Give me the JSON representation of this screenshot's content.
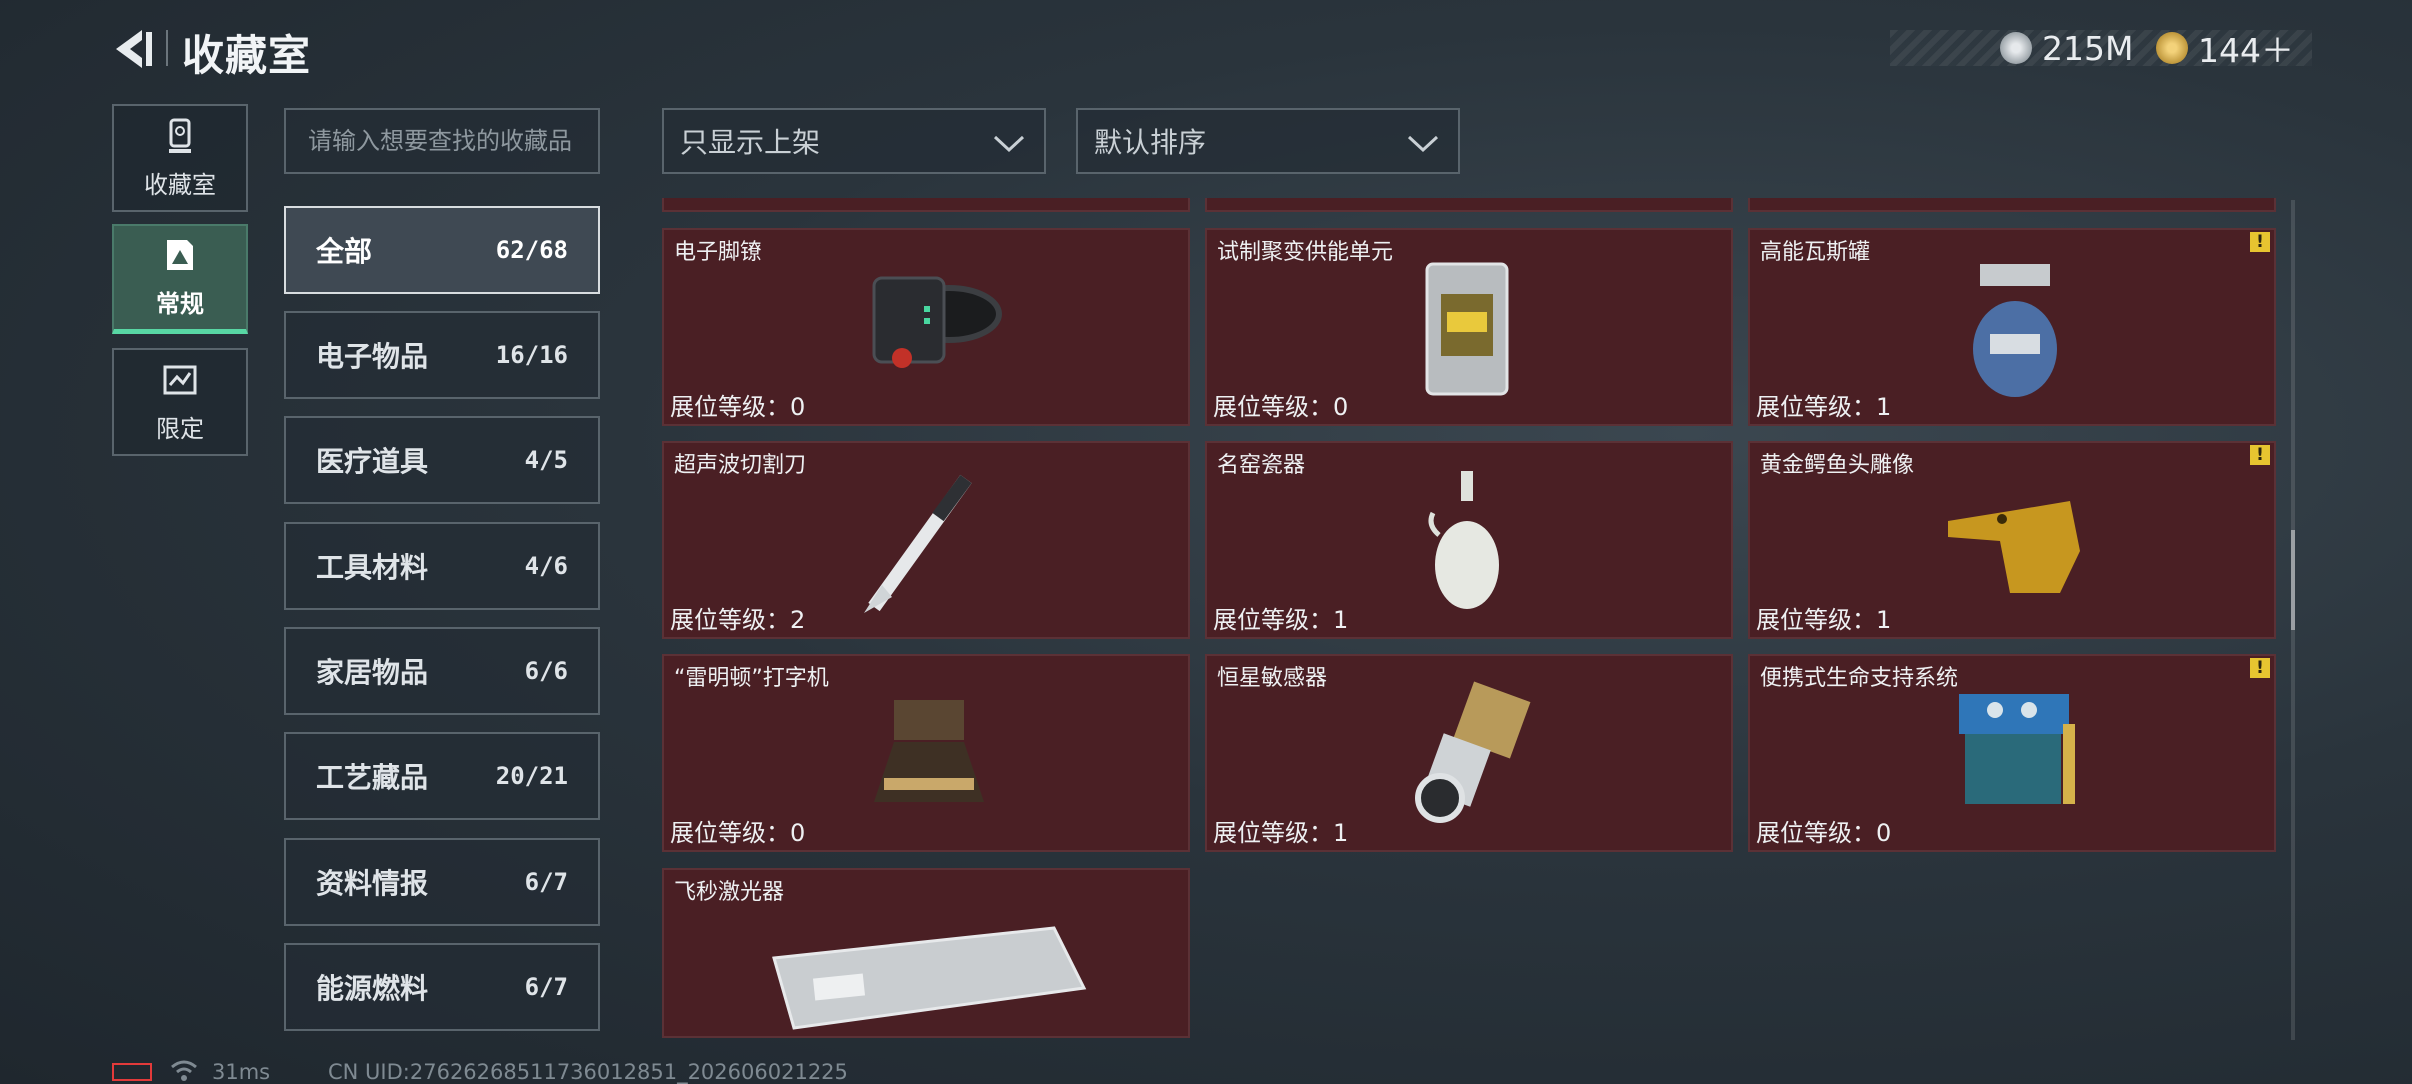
{
  "header": {
    "title": "收藏室"
  },
  "currency": {
    "silver": "215M",
    "gold": "144＋"
  },
  "rail": [
    {
      "label": "收藏室",
      "icon": "trophy-icon"
    },
    {
      "label": "常规",
      "icon": "collection-icon",
      "active": true
    },
    {
      "label": "限定",
      "icon": "limited-icon"
    }
  ],
  "search": {
    "placeholder": "请输入想要查找的收藏品"
  },
  "filters": {
    "display": "只显示上架",
    "sort": "默认排序"
  },
  "categories": [
    {
      "label": "全部",
      "count": "62/68",
      "active": true
    },
    {
      "label": "电子物品",
      "count": "16/16"
    },
    {
      "label": "医疗道具",
      "count": "4/5"
    },
    {
      "label": "工具材料",
      "count": "4/6"
    },
    {
      "label": "家居物品",
      "count": "6/6"
    },
    {
      "label": "工艺藏品",
      "count": "20/21"
    },
    {
      "label": "资料情报",
      "count": "6/7"
    },
    {
      "label": "能源燃料",
      "count": "6/7"
    }
  ],
  "level_prefix": "展位等级：",
  "items": [
    {
      "name": "电子脚镣",
      "level": "展位等级：0",
      "warn": false,
      "icon": "ankle-monitor-icon"
    },
    {
      "name": "试制聚变供能单元",
      "level": "展位等级：0",
      "warn": false,
      "icon": "fusion-cell-icon"
    },
    {
      "name": "高能瓦斯罐",
      "level": "展位等级：1",
      "warn": true,
      "icon": "gas-canister-icon"
    },
    {
      "name": "超声波切割刀",
      "level": "展位等级：2",
      "warn": false,
      "icon": "ultrasonic-knife-icon"
    },
    {
      "name": "名窑瓷器",
      "level": "展位等级：1",
      "warn": false,
      "icon": "porcelain-vase-icon"
    },
    {
      "name": "黄金鳄鱼头雕像",
      "level": "展位等级：1",
      "warn": true,
      "icon": "gold-crocodile-icon"
    },
    {
      "name": "“雷明顿”打字机",
      "level": "展位等级：0",
      "warn": false,
      "icon": "typewriter-icon"
    },
    {
      "name": "恒星敏感器",
      "level": "展位等级：1",
      "warn": false,
      "icon": "star-sensor-icon"
    },
    {
      "name": "便携式生命支持系统",
      "level": "展位等级：0",
      "warn": true,
      "icon": "life-support-icon"
    },
    {
      "name": "飞秒激光器",
      "level": "",
      "warn": false,
      "icon": "femtosecond-laser-icon"
    }
  ],
  "warn_mark": "!",
  "status": {
    "ping": "31ms",
    "uid": "CN UID:2762626851173601285​1_202606021225"
  },
  "colors": {
    "card_bg": "#4a1f24",
    "active_accent": "#58d7a4",
    "warning": "#e7c430"
  }
}
